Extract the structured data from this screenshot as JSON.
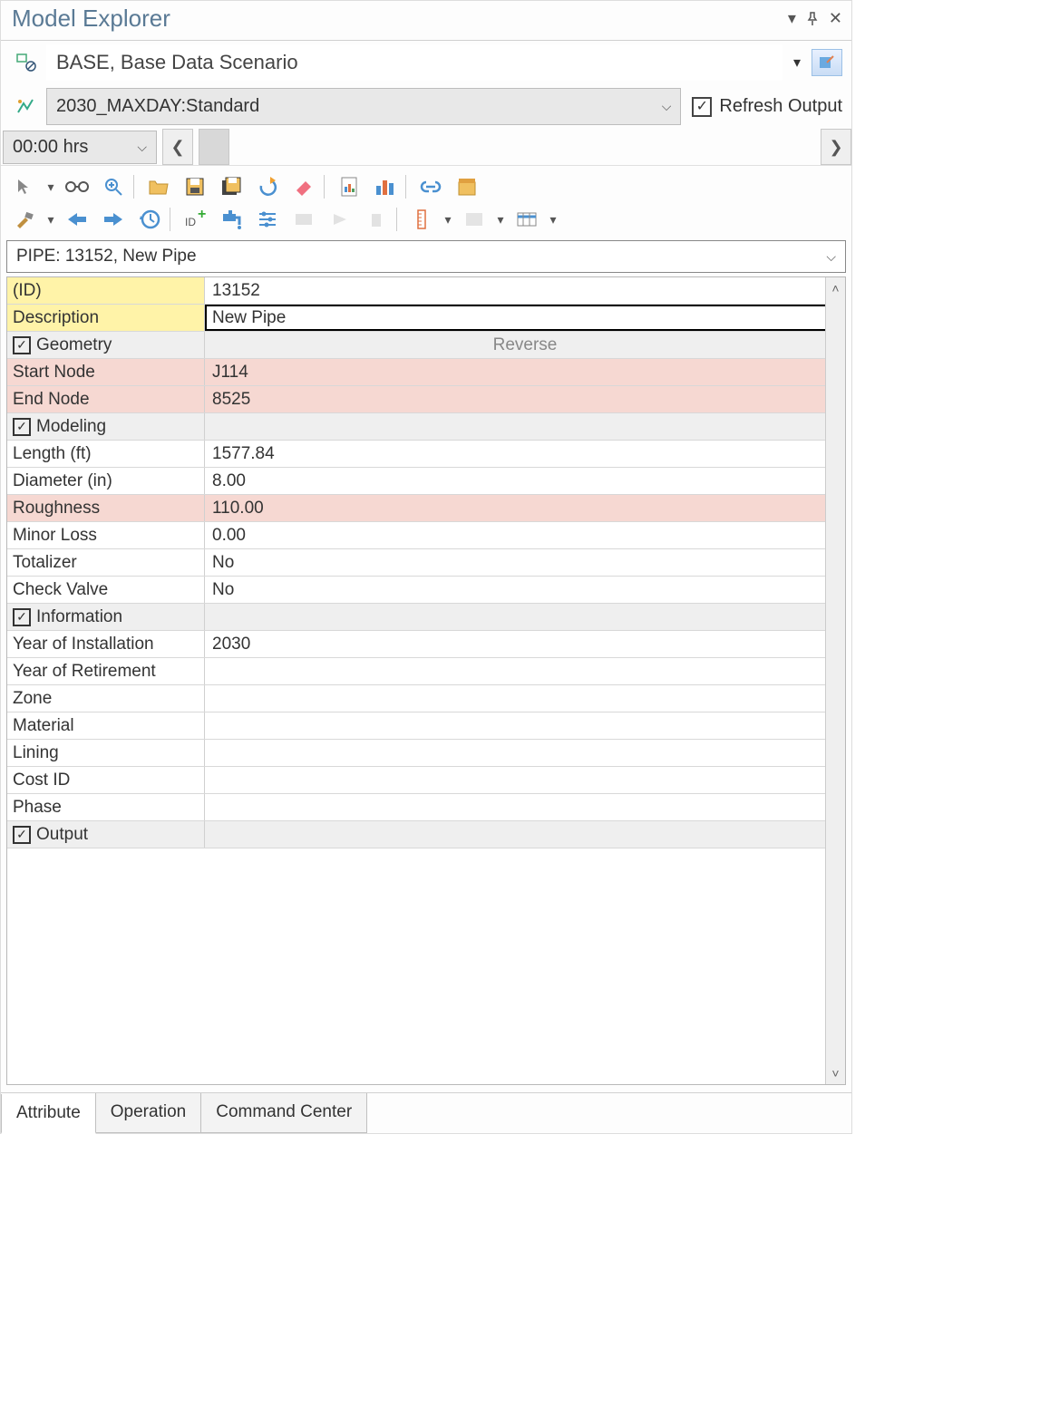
{
  "header": {
    "title": "Model Explorer"
  },
  "scenario": {
    "value": "BASE, Base Data Scenario"
  },
  "simulation": {
    "value": "2030_MAXDAY:Standard"
  },
  "refresh": {
    "label": "Refresh Output",
    "checked": true
  },
  "time": {
    "value": "00:00 hrs"
  },
  "selector": {
    "text": "PIPE: 13152, New Pipe"
  },
  "sections": {
    "geometry": {
      "label": "Geometry",
      "action": "Reverse"
    },
    "modeling": {
      "label": "Modeling"
    },
    "information": {
      "label": "Information"
    },
    "output": {
      "label": "Output"
    }
  },
  "props": {
    "id": {
      "label": "(ID)",
      "value": "13152"
    },
    "description": {
      "label": "Description",
      "value": "New Pipe"
    },
    "start_node": {
      "label": "Start Node",
      "value": "J114"
    },
    "end_node": {
      "label": "End Node",
      "value": "8525"
    },
    "length": {
      "label": "Length (ft)",
      "value": "1577.84"
    },
    "diameter": {
      "label": "Diameter (in)",
      "value": "8.00"
    },
    "roughness": {
      "label": "Roughness",
      "value": "110.00"
    },
    "minor_loss": {
      "label": "Minor Loss",
      "value": "0.00"
    },
    "totalizer": {
      "label": "Totalizer",
      "value": "No"
    },
    "check_valve": {
      "label": "Check Valve",
      "value": "No"
    },
    "year_install": {
      "label": "Year of Installation",
      "value": "2030"
    },
    "year_retire": {
      "label": "Year of Retirement",
      "value": ""
    },
    "zone": {
      "label": "Zone",
      "value": ""
    },
    "material": {
      "label": "Material",
      "value": ""
    },
    "lining": {
      "label": "Lining",
      "value": ""
    },
    "cost_id": {
      "label": "Cost ID",
      "value": ""
    },
    "phase": {
      "label": "Phase",
      "value": ""
    }
  },
  "tabs": {
    "attribute": "Attribute",
    "operation": "Operation",
    "command": "Command Center"
  }
}
